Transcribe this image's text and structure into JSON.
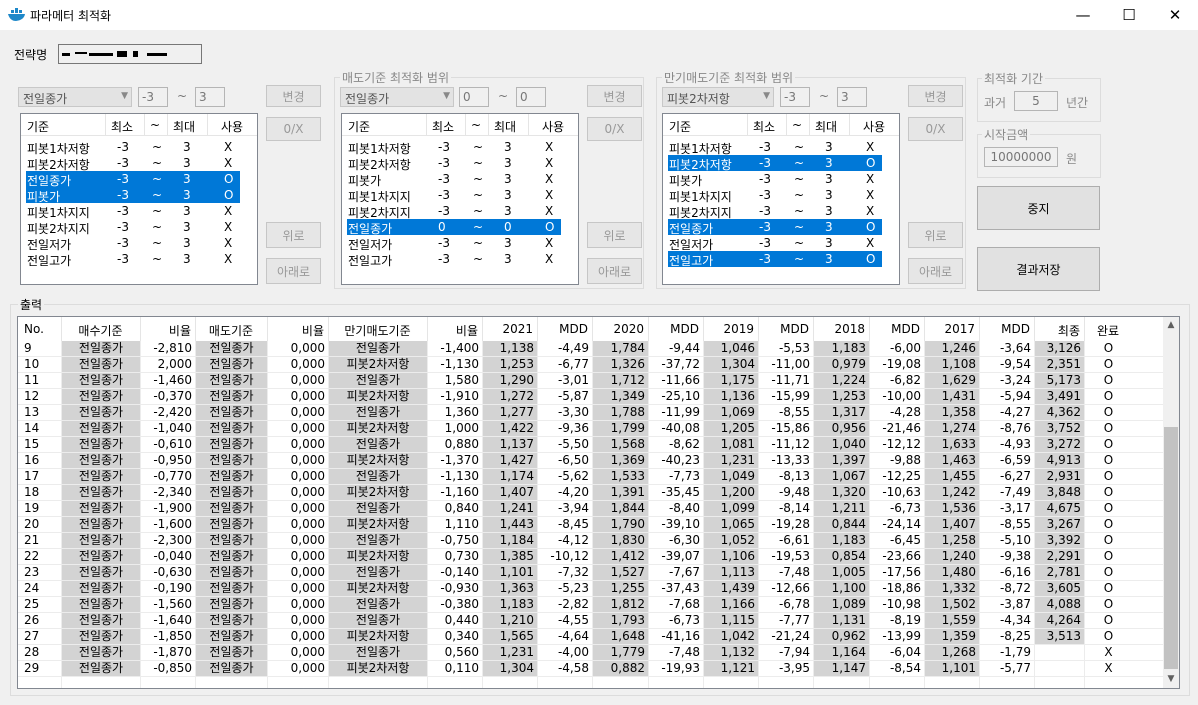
{
  "window": {
    "title": "파라메터 최적화",
    "minimize": "—",
    "maximize": "☐",
    "close": "✕"
  },
  "strategy": {
    "label": "전략명"
  },
  "panel1": {
    "combo": "전일종가",
    "min": "-3",
    "tilde": "~",
    "max": "3",
    "btn_change": "변경",
    "btn_ox": "0/X",
    "btn_up": "위로",
    "btn_down": "아래로",
    "headers": [
      "기준",
      "최소",
      "~",
      "최대",
      "사용"
    ],
    "rows": [
      {
        "name": "피봇1차저항",
        "min": "-3",
        "t": "~",
        "max": "3",
        "use": "X",
        "sel": false
      },
      {
        "name": "피봇2차저항",
        "min": "-3",
        "t": "~",
        "max": "3",
        "use": "X",
        "sel": false
      },
      {
        "name": "전일종가",
        "min": "-3",
        "t": "~",
        "max": "3",
        "use": "O",
        "sel": true
      },
      {
        "name": "피봇가",
        "min": "-3",
        "t": "~",
        "max": "3",
        "use": "O",
        "sel": true
      },
      {
        "name": "피봇1차지지",
        "min": "-3",
        "t": "~",
        "max": "3",
        "use": "X",
        "sel": false
      },
      {
        "name": "피봇2차지지",
        "min": "-3",
        "t": "~",
        "max": "3",
        "use": "X",
        "sel": false
      },
      {
        "name": "전일저가",
        "min": "-3",
        "t": "~",
        "max": "3",
        "use": "X",
        "sel": false
      },
      {
        "name": "전일고가",
        "min": "-3",
        "t": "~",
        "max": "3",
        "use": "X",
        "sel": false
      }
    ]
  },
  "panel2": {
    "title": "매도기준 최적화 범위",
    "combo": "전일종가",
    "min": "0",
    "tilde": "~",
    "max": "0",
    "btn_change": "변경",
    "btn_ox": "0/X",
    "btn_up": "위로",
    "btn_down": "아래로",
    "headers": [
      "기준",
      "최소",
      "~",
      "최대",
      "사용"
    ],
    "rows": [
      {
        "name": "피봇1차저항",
        "min": "-3",
        "t": "~",
        "max": "3",
        "use": "X",
        "sel": false
      },
      {
        "name": "피봇2차저항",
        "min": "-3",
        "t": "~",
        "max": "3",
        "use": "X",
        "sel": false
      },
      {
        "name": "피봇가",
        "min": "-3",
        "t": "~",
        "max": "3",
        "use": "X",
        "sel": false
      },
      {
        "name": "피봇1차지지",
        "min": "-3",
        "t": "~",
        "max": "3",
        "use": "X",
        "sel": false
      },
      {
        "name": "피봇2차지지",
        "min": "-3",
        "t": "~",
        "max": "3",
        "use": "X",
        "sel": false
      },
      {
        "name": "전일종가",
        "min": "0",
        "t": "~",
        "max": "0",
        "use": "O",
        "sel": true
      },
      {
        "name": "전일저가",
        "min": "-3",
        "t": "~",
        "max": "3",
        "use": "X",
        "sel": false
      },
      {
        "name": "전일고가",
        "min": "-3",
        "t": "~",
        "max": "3",
        "use": "X",
        "sel": false
      }
    ]
  },
  "panel3": {
    "title": "만기매도기준 최적화 범위",
    "combo": "피봇2차저항",
    "min": "-3",
    "tilde": "~",
    "max": "3",
    "btn_change": "변경",
    "btn_ox": "0/X",
    "btn_up": "위로",
    "btn_down": "아래로",
    "headers": [
      "기준",
      "최소",
      "~",
      "최대",
      "사용"
    ],
    "rows": [
      {
        "name": "피봇1차저항",
        "min": "-3",
        "t": "~",
        "max": "3",
        "use": "X",
        "sel": false
      },
      {
        "name": "피봇2차저항",
        "min": "-3",
        "t": "~",
        "max": "3",
        "use": "O",
        "sel": true
      },
      {
        "name": "피봇가",
        "min": "-3",
        "t": "~",
        "max": "3",
        "use": "X",
        "sel": false
      },
      {
        "name": "피봇1차지지",
        "min": "-3",
        "t": "~",
        "max": "3",
        "use": "X",
        "sel": false
      },
      {
        "name": "피봇2차지지",
        "min": "-3",
        "t": "~",
        "max": "3",
        "use": "X",
        "sel": false
      },
      {
        "name": "전일종가",
        "min": "-3",
        "t": "~",
        "max": "3",
        "use": "O",
        "sel": true
      },
      {
        "name": "전일저가",
        "min": "-3",
        "t": "~",
        "max": "3",
        "use": "X",
        "sel": false
      },
      {
        "name": "전일고가",
        "min": "-3",
        "t": "~",
        "max": "3",
        "use": "O",
        "sel": true
      }
    ]
  },
  "period": {
    "title": "최적화 기간",
    "prefix": "과거",
    "value": "5",
    "suffix": "년간"
  },
  "capital": {
    "title": "시작금액",
    "value": "10000000",
    "suffix": "원"
  },
  "buttons": {
    "stop": "중지",
    "save": "결과저장"
  },
  "output": {
    "label": "출력",
    "headers": [
      "No.",
      "매수기준",
      "비율",
      "매도기준",
      "비율",
      "만기매도기준",
      "비율",
      "2021",
      "MDD",
      "2020",
      "MDD",
      "2019",
      "MDD",
      "2018",
      "MDD",
      "2017",
      "MDD",
      "최종",
      "완료"
    ],
    "rows": [
      [
        "9",
        "전일종가",
        "-2,810",
        "전일종가",
        "0,000",
        "전일종가",
        "-1,400",
        "1,138",
        "-4,49",
        "1,784",
        "-9,44",
        "1,046",
        "-5,53",
        "1,183",
        "-6,00",
        "1,246",
        "-3,64",
        "3,126",
        "O"
      ],
      [
        "10",
        "전일종가",
        "2,000",
        "전일종가",
        "0,000",
        "피봇2차저항",
        "-1,130",
        "1,253",
        "-6,77",
        "1,326",
        "-37,72",
        "1,304",
        "-11,00",
        "0,979",
        "-19,08",
        "1,108",
        "-9,54",
        "2,351",
        "O"
      ],
      [
        "11",
        "전일종가",
        "-1,460",
        "전일종가",
        "0,000",
        "전일종가",
        "1,580",
        "1,290",
        "-3,01",
        "1,712",
        "-11,66",
        "1,175",
        "-11,71",
        "1,224",
        "-6,82",
        "1,629",
        "-3,24",
        "5,173",
        "O"
      ],
      [
        "12",
        "전일종가",
        "-0,370",
        "전일종가",
        "0,000",
        "피봇2차저항",
        "-1,910",
        "1,272",
        "-5,87",
        "1,349",
        "-25,10",
        "1,136",
        "-15,99",
        "1,253",
        "-10,00",
        "1,431",
        "-5,94",
        "3,491",
        "O"
      ],
      [
        "13",
        "전일종가",
        "-2,420",
        "전일종가",
        "0,000",
        "전일종가",
        "1,360",
        "1,277",
        "-3,30",
        "1,788",
        "-11,99",
        "1,069",
        "-8,55",
        "1,317",
        "-4,28",
        "1,358",
        "-4,27",
        "4,362",
        "O"
      ],
      [
        "14",
        "전일종가",
        "-1,040",
        "전일종가",
        "0,000",
        "피봇2차저항",
        "1,000",
        "1,422",
        "-9,36",
        "1,799",
        "-40,08",
        "1,205",
        "-15,86",
        "0,956",
        "-21,46",
        "1,274",
        "-8,76",
        "3,752",
        "O"
      ],
      [
        "15",
        "전일종가",
        "-0,610",
        "전일종가",
        "0,000",
        "전일종가",
        "0,880",
        "1,137",
        "-5,50",
        "1,568",
        "-8,62",
        "1,081",
        "-11,12",
        "1,040",
        "-12,12",
        "1,633",
        "-4,93",
        "3,272",
        "O"
      ],
      [
        "16",
        "전일종가",
        "-0,950",
        "전일종가",
        "0,000",
        "피봇2차저항",
        "-1,370",
        "1,427",
        "-6,50",
        "1,369",
        "-40,23",
        "1,231",
        "-13,33",
        "1,397",
        "-9,88",
        "1,463",
        "-6,59",
        "4,913",
        "O"
      ],
      [
        "17",
        "전일종가",
        "-0,770",
        "전일종가",
        "0,000",
        "전일종가",
        "-1,130",
        "1,174",
        "-5,62",
        "1,533",
        "-7,73",
        "1,049",
        "-8,13",
        "1,067",
        "-12,25",
        "1,455",
        "-6,27",
        "2,931",
        "O"
      ],
      [
        "18",
        "전일종가",
        "-2,340",
        "전일종가",
        "0,000",
        "피봇2차저항",
        "-1,160",
        "1,407",
        "-4,20",
        "1,391",
        "-35,45",
        "1,200",
        "-9,48",
        "1,320",
        "-10,63",
        "1,242",
        "-7,49",
        "3,848",
        "O"
      ],
      [
        "19",
        "전일종가",
        "-1,900",
        "전일종가",
        "0,000",
        "전일종가",
        "0,840",
        "1,241",
        "-3,94",
        "1,844",
        "-8,40",
        "1,099",
        "-8,14",
        "1,211",
        "-6,73",
        "1,536",
        "-3,17",
        "4,675",
        "O"
      ],
      [
        "20",
        "전일종가",
        "-1,600",
        "전일종가",
        "0,000",
        "피봇2차저항",
        "1,110",
        "1,443",
        "-8,45",
        "1,790",
        "-39,10",
        "1,065",
        "-19,28",
        "0,844",
        "-24,14",
        "1,407",
        "-8,55",
        "3,267",
        "O"
      ],
      [
        "21",
        "전일종가",
        "-2,300",
        "전일종가",
        "0,000",
        "전일종가",
        "-0,750",
        "1,184",
        "-4,12",
        "1,830",
        "-6,30",
        "1,052",
        "-6,61",
        "1,183",
        "-6,45",
        "1,258",
        "-5,10",
        "3,392",
        "O"
      ],
      [
        "22",
        "전일종가",
        "-0,040",
        "전일종가",
        "0,000",
        "피봇2차저항",
        "0,730",
        "1,385",
        "-10,12",
        "1,412",
        "-39,07",
        "1,106",
        "-19,53",
        "0,854",
        "-23,66",
        "1,240",
        "-9,38",
        "2,291",
        "O"
      ],
      [
        "23",
        "전일종가",
        "-0,630",
        "전일종가",
        "0,000",
        "전일종가",
        "-0,140",
        "1,101",
        "-7,32",
        "1,527",
        "-7,67",
        "1,113",
        "-7,48",
        "1,005",
        "-17,56",
        "1,480",
        "-6,16",
        "2,781",
        "O"
      ],
      [
        "24",
        "전일종가",
        "-0,190",
        "전일종가",
        "0,000",
        "피봇2차저항",
        "-0,930",
        "1,363",
        "-5,23",
        "1,255",
        "-37,43",
        "1,439",
        "-12,66",
        "1,100",
        "-18,86",
        "1,332",
        "-8,72",
        "3,605",
        "O"
      ],
      [
        "25",
        "전일종가",
        "-1,560",
        "전일종가",
        "0,000",
        "전일종가",
        "-0,380",
        "1,183",
        "-2,82",
        "1,812",
        "-7,68",
        "1,166",
        "-6,78",
        "1,089",
        "-10,98",
        "1,502",
        "-3,87",
        "4,088",
        "O"
      ],
      [
        "26",
        "전일종가",
        "-1,640",
        "전일종가",
        "0,000",
        "전일종가",
        "0,440",
        "1,210",
        "-4,55",
        "1,793",
        "-6,73",
        "1,115",
        "-7,77",
        "1,131",
        "-8,19",
        "1,559",
        "-4,34",
        "4,264",
        "O"
      ],
      [
        "27",
        "전일종가",
        "-1,850",
        "전일종가",
        "0,000",
        "피봇2차저항",
        "0,340",
        "1,565",
        "-4,64",
        "1,648",
        "-41,16",
        "1,042",
        "-21,24",
        "0,962",
        "-13,99",
        "1,359",
        "-8,25",
        "3,513",
        "O"
      ],
      [
        "28",
        "전일종가",
        "-1,870",
        "전일종가",
        "0,000",
        "전일종가",
        "0,560",
        "1,231",
        "-4,00",
        "1,779",
        "-7,48",
        "1,132",
        "-7,94",
        "1,164",
        "-6,04",
        "1,268",
        "-1,79",
        "",
        "X"
      ],
      [
        "29",
        "전일종가",
        "-0,850",
        "전일종가",
        "0,000",
        "피봇2차저항",
        "0,110",
        "1,304",
        "-4,58",
        "0,882",
        "-19,93",
        "1,121",
        "-3,95",
        "1,147",
        "-8,54",
        "1,101",
        "-5,77",
        "",
        "X"
      ]
    ]
  }
}
